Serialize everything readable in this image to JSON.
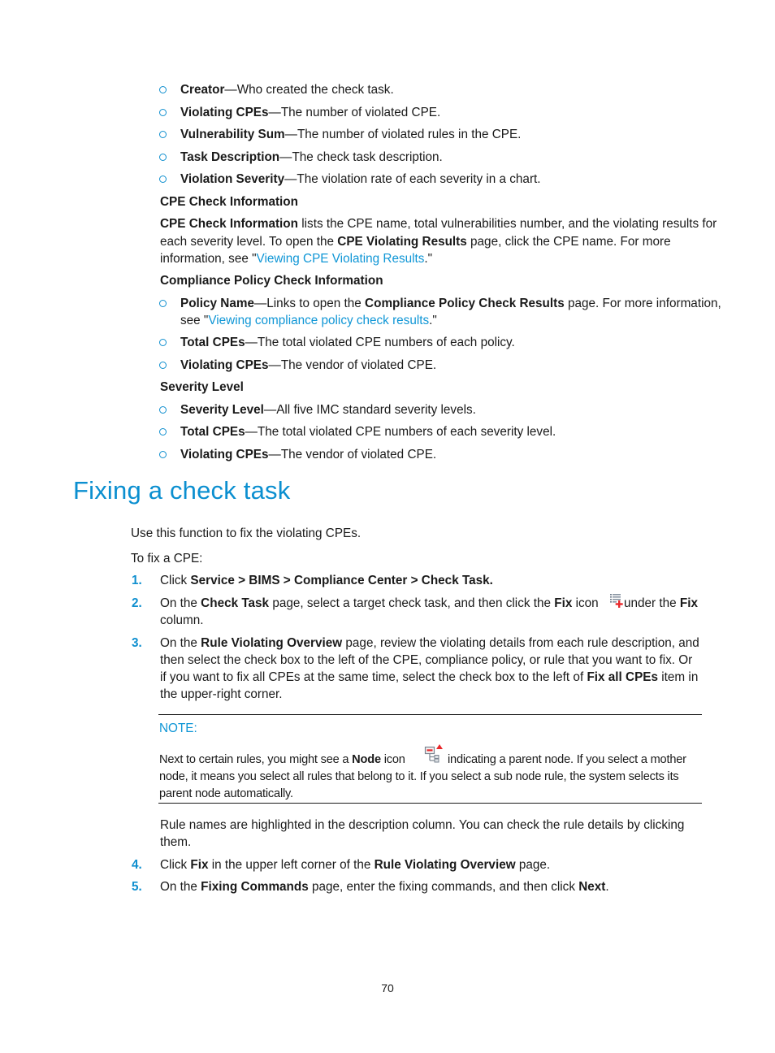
{
  "task_list_items": [
    {
      "term": "Creator",
      "desc": "—Who created the check task."
    },
    {
      "term": "Violating CPEs",
      "desc": "—The number of violated CPE."
    },
    {
      "term": "Vulnerability Sum",
      "desc": "—The number of violated rules in the CPE."
    },
    {
      "term": "Task Description",
      "desc": "—The check task description."
    },
    {
      "term": "Violation Severity",
      "desc": "—The violation rate of each severity in a chart."
    }
  ],
  "cpe_check": {
    "heading": "CPE Check Information",
    "line1_bold": "CPE Check Information",
    "line1_rest": " lists the CPE name, total vulnerabilities number, and the violating results for",
    "line2_pre": "each severity level. To open the ",
    "line2_bold": "CPE Violating Results",
    "line2_post": " page, click the CPE name. For more",
    "line3_pre": "information, see \"",
    "line3_link": "Viewing CPE Violating Results",
    "line3_post": ".\""
  },
  "compliance_policy": {
    "heading": "Compliance Policy Check Information",
    "items": [
      {
        "term": "Policy Name",
        "desc_pre": "—Links to open the ",
        "desc_bold": "Compliance Policy Check Results",
        "desc_post": " page. For more information,",
        "line2_pre": "see \"",
        "line2_link": "Viewing compliance policy check results",
        "line2_post": ".\""
      },
      {
        "term": "Total CPEs",
        "desc": "—The total violated CPE numbers of each policy."
      },
      {
        "term": "Violating CPEs",
        "desc": "—The vendor of violated CPE."
      }
    ]
  },
  "severity_level": {
    "heading": "Severity Level",
    "items": [
      {
        "term": "Severity Level",
        "desc": "—All five IMC standard severity levels."
      },
      {
        "term": "Total CPEs",
        "desc": "—The total violated CPE numbers of each severity level."
      },
      {
        "term": "Violating CPEs",
        "desc": "—The vendor of violated CPE."
      }
    ]
  },
  "section": {
    "title": "Fixing a check task",
    "intro": "Use this function to fix the violating CPEs.",
    "to_fix": "To fix a CPE:"
  },
  "steps": {
    "s1": {
      "num": "1.",
      "pre": "Click ",
      "bold": "Service > BIMS > Compliance Center > Check Task."
    },
    "s2": {
      "num": "2.",
      "t1": "On the ",
      "b1": "Check Task",
      "t2": " page, select a target check task, and then click the ",
      "b2": "Fix",
      "t3": " icon ",
      "t4": "under the ",
      "b3": "Fix",
      "line2": "column.",
      "icon": "fix-icon"
    },
    "s3": {
      "num": "3.",
      "l1_pre": "On the ",
      "l1_bold": "Rule Violating Overview",
      "l1_post": " page, review the violating details from each rule description, and",
      "l2": "then select the check box to the left of the CPE, compliance policy, or rule that you want to fix. Or",
      "l3_pre": "if you want to fix all CPEs at the same time, select the check box to the left of ",
      "l3_bold": "Fix all CPEs",
      "l3_post": " item in",
      "l4": "the upper-right corner."
    },
    "s4": {
      "num": "4.",
      "t1": "Click ",
      "b1": "Fix",
      "t2": " in the upper left corner of the ",
      "b2": "Rule Violating Overview",
      "t3": " page."
    },
    "s5": {
      "num": "5.",
      "t1": "On the ",
      "b1": "Fixing Commands",
      "t2": " page, enter the fixing commands, and then click ",
      "b2": "Next",
      "t3": "."
    }
  },
  "note": {
    "label": "NOTE:",
    "l1_pre": "Next to certain rules, you might see a ",
    "l1_bold": "Node",
    "l1_mid": " icon ",
    "l1_post": " indicating a parent node. If you select a mother",
    "l2": "node, it means you select all rules that belong to it. If you select a sub node rule, the system selects its",
    "l3": "parent node automatically.",
    "icon": "node-icon"
  },
  "rule_names_note": {
    "l1": "Rule names are highlighted in the description column. You can check the rule details by clicking",
    "l2": "them."
  },
  "page_number": "70",
  "colors": {
    "heading": "#0b8fd0",
    "link": "#0f96d6",
    "step_number": "#0f8fcf",
    "fix_icon_plus": "#e8282b",
    "node_icon_arrow": "#e8282b"
  }
}
